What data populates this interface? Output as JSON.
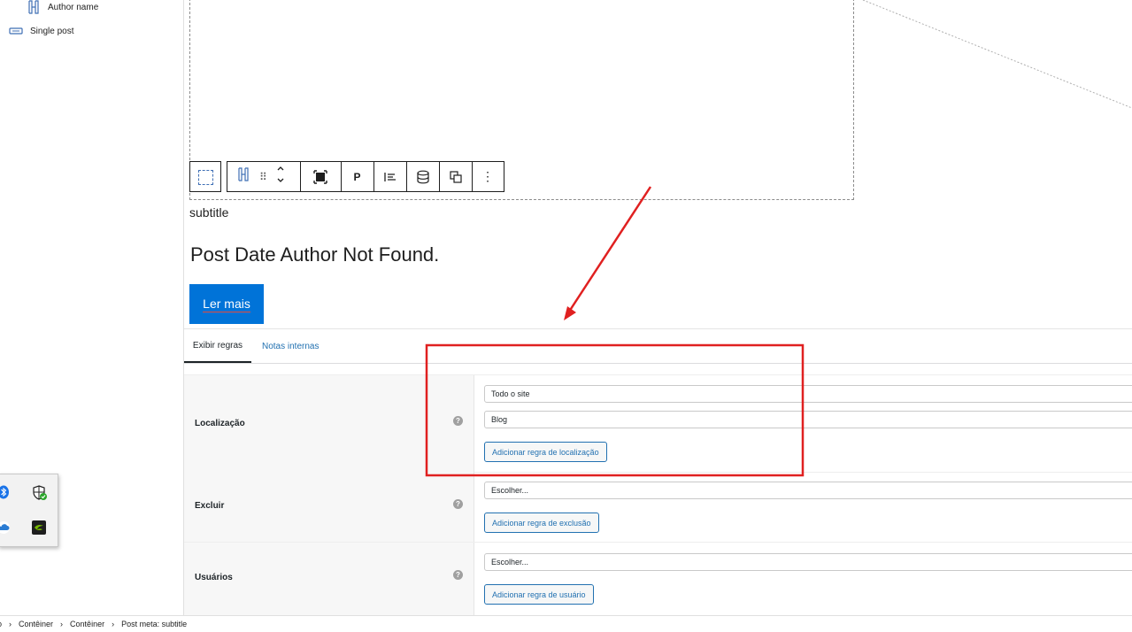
{
  "list_view": {
    "items": [
      {
        "label": "Author name",
        "icon": "heading-icon"
      },
      {
        "label": "Single post",
        "icon": "button-icon"
      }
    ]
  },
  "block_toolbar": {
    "paragraph_label": "P"
  },
  "content": {
    "subtitle": "subtitle",
    "post_title": "Post Date Author Not Found.",
    "read_more": "Ler mais"
  },
  "metabox": {
    "tabs": [
      {
        "label": "Exibir regras",
        "active": true
      },
      {
        "label": "Notas internas",
        "active": false
      }
    ],
    "rows": [
      {
        "label": "Localização",
        "selects": [
          "Todo o site",
          "Blog"
        ],
        "button": "Adicionar regra de localização"
      },
      {
        "label": "Excluir",
        "selects": [
          "Escolher..."
        ],
        "button": "Adicionar regra de exclusão"
      },
      {
        "label": "Usuários",
        "selects": [
          "Escolher..."
        ],
        "button": "Adicionar regra de usuário"
      }
    ],
    "help_glyph": "?"
  },
  "breadcrumb": {
    "items": [
      "o",
      "Contêiner",
      "Contêiner",
      "Post meta: subtitle"
    ],
    "separator": "›"
  },
  "annotation": {
    "color": "#e02020"
  },
  "colors": {
    "button_blue": "#0073d8",
    "link_blue": "#2271b1"
  }
}
